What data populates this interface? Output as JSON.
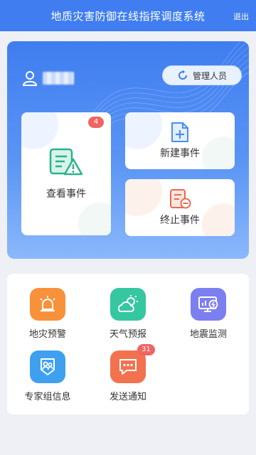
{
  "header": {
    "title": "地质灾害防御在线指挥调度系统",
    "logout_label": "退出"
  },
  "user": {
    "role_label": "管理人员"
  },
  "cards": {
    "view_events": {
      "label": "查看事件",
      "badge": "4"
    },
    "new_event": {
      "label": "新建事件"
    },
    "end_event": {
      "label": "终止事件"
    }
  },
  "functions": [
    {
      "label": "地灾预警",
      "icon": "alarm-light-icon",
      "color": "#f7913a"
    },
    {
      "label": "天气预报",
      "icon": "weather-icon",
      "color": "#34c7a0"
    },
    {
      "label": "地震监测",
      "icon": "monitor-icon",
      "color": "#7c7fef"
    },
    {
      "label": "专家组信息",
      "icon": "expert-group-icon",
      "color": "#3fa0f0"
    },
    {
      "label": "发送通知",
      "icon": "message-icon",
      "color": "#f2724f",
      "badge": "31"
    }
  ]
}
